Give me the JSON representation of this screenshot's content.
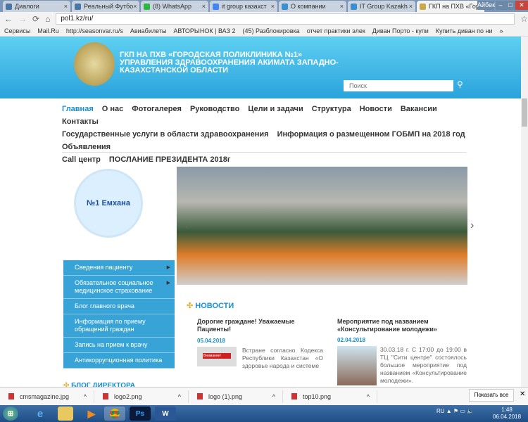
{
  "browser": {
    "tabs": [
      {
        "label": "Диалоги",
        "color": "#4a76a8"
      },
      {
        "label": "Реальный Футбо",
        "color": "#4a76a8"
      },
      {
        "label": "(8) WhatsApp",
        "color": "#2bb741"
      },
      {
        "label": "it group казахст",
        "color": "#4285f4"
      },
      {
        "label": "О компании",
        "color": "#3a8fd0"
      },
      {
        "label": "IT Group Kazakh",
        "color": "#3a8fd0"
      },
      {
        "label": "ГКП на ПХВ «Гор",
        "color": "#c9a94a",
        "active": true
      }
    ],
    "user": "Айбек",
    "url": "pol1.kz/ru/",
    "bookmarks": [
      "Сервисы",
      "Mail.Ru",
      "http://seasonvar.ru/s",
      "Авиабилеты",
      "АВТОРЫНОК | ВАЗ 2",
      "(45) Разблокировка",
      "отчет практики элек",
      "Диван Порто - купи",
      "Купить диван по ни"
    ],
    "bookmarks_more": "»"
  },
  "header": {
    "title_lines": [
      "ГКП НА ПХВ «ГОРОДСКАЯ ПОЛИКЛИНИКА №1»",
      "УПРАВЛЕНИЯ ЗДРАВООХРАНЕНИЯ АКИМАТА ЗАПАДНО-",
      "КАЗАХСТАНСКОЙ ОБЛАСТИ"
    ],
    "search_placeholder": "Поиск"
  },
  "nav": [
    "Главная",
    "О нас",
    "Фотогалерея",
    "Руководство",
    "Цели и задачи",
    "Структура",
    "Новости",
    "Вакансии",
    "Контакты",
    "Государственные услуги в области здравоохранения",
    "Информация о размещенном ГОБМП на 2018 год",
    "Объявления",
    "Call центр",
    "ПОСЛАНИЕ ПРЕЗИДЕНТА 2018г"
  ],
  "logo": {
    "text": "№1 Емхана"
  },
  "sidebar": [
    {
      "label": "Сведения пациенту",
      "sub": true
    },
    {
      "label": "Обязательное социальное медицинское страхование",
      "sub": true
    },
    {
      "label": "Блог главного врача"
    },
    {
      "label": "Информация по приему обращений граждан"
    },
    {
      "label": "Запись на прием к врачу"
    },
    {
      "label": "Антикоррупционная политика"
    }
  ],
  "news": {
    "heading": "НОВОСТИ",
    "items": [
      {
        "title": "Дорогие граждане! Уважаемые Пациенты!",
        "date": "05.04.2018",
        "text": "Встране согласно Кодекса Республики Казахстан «О здоровье народа и системе"
      },
      {
        "title": "Мероприятие под названием «Консультирование молодежи»",
        "date": "02.04.2018",
        "text": "30.03.18 г. С 17:00 до 19:00 в ТЦ \"Сити центре\" состоялось большое мероприятие под названием «Консультирование молодежи»."
      }
    ]
  },
  "blog_heading": "БЛОГ ДИРЕКТОРА",
  "downloads": [
    "cmsmagazine.jpg",
    "logo2.png",
    "logo (1).png",
    "top10.png"
  ],
  "show_all": "Показать все",
  "tray": {
    "lang": "RU",
    "time": "1:48",
    "date": "06.04.2018"
  }
}
